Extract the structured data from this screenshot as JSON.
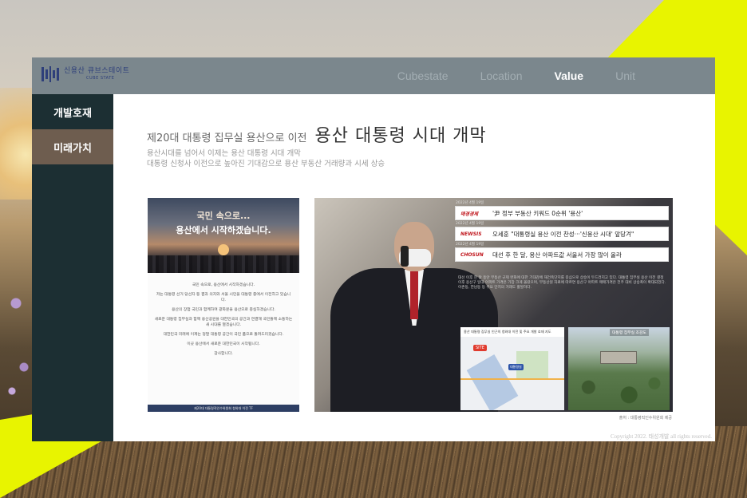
{
  "brand": {
    "name": "신용산 큐브스테이트",
    "sub": "CUBE STATE"
  },
  "nav": [
    {
      "label": "Cubestate"
    },
    {
      "label": "Location"
    },
    {
      "label": "Value"
    },
    {
      "label": "Unit"
    }
  ],
  "sidebar": [
    {
      "label": "개발호재"
    },
    {
      "label": "미래가치"
    }
  ],
  "headline": {
    "pre": "제20대 대통령 집무실 용산으로 이전",
    "main": "용산 대통령 시대 개막"
  },
  "subtitle": {
    "line1": "용산시대를 넘어서 이제는 용산 대통령 시대 개막",
    "line2": "대통령 신청사 이전으로 높아진 기대감으로 용산 부동산 거래량과 시세 상승"
  },
  "letter": {
    "title1": "국민 속으로...",
    "title2": "용산에서 시작하겠습니다.",
    "paragraphs": [
      "국민 속으로, 용산에서 시작하겠습니다.",
      "저는 대통령 선거 당선자 등 결과 의지와 서울 시민을 대통령 중에서 이전하고 있습니다.",
      "용산의 장점 국민과 함께하여 광화문을 용산으로 충실하겠습니다.",
      "새로운 대통령 집무실과 함께 용산공원을 대한민국의 공간과 연결해 국민들께 소통하는 새 시대를 열겠습니다.",
      "대한민국 미래에 이제는 정말 대통령 공간이 국민 품으로 돌려드리겠습니다.",
      "이곳 용산에서 새로운 대한민국이 시작됩니다.",
      "감사합니다."
    ],
    "footer": "제20대 대통령직인수위원회 청와대 이전 TF"
  },
  "news": [
    {
      "date": "2022년 4월 19일",
      "source": "매경경제",
      "text": "'尹 정부 부동산 키워드 0순위 '용산'"
    },
    {
      "date": "2022년 4월 19일",
      "source": "NEWSIS",
      "text": "오세훈 \"대통령실 용산 이전 찬성···'신용산 시대' 앞당겨\""
    },
    {
      "date": "2022년 4월 19일",
      "source": "CHOSUN",
      "text": "대선 후 한 달, 용산 아파트값 서울서 가장 많이 올라"
    }
  ],
  "photo_paragraph": "대선 이후 한 달 동안 부동산 규제 완화에 대한 기대감에 재건축단지를 중심으로 상승이 두드러지고 있다. 대통령 집무실 용산 이전 결정 이후 용산구 일대 아파트 가격은 가장 크게 올랐으며, 부동산원 자료에 따르면 용산구 아파트 매매가격은 전주 대비 상승폭이 확대되었다. 이촌동, 한남동 등 주요 단지의 거래도 활발하다.",
  "map": {
    "caption": "용산 대통령 집무실 인근의 청와대 이전 및 주요 개발 호재 지도",
    "pin": "SITE",
    "pin2": "대통령실"
  },
  "aerial": {
    "caption": "대통령 집무실 조감도"
  },
  "source": "출처 : 대통령직인수위원회 제공",
  "copyright": "Copyright 2022. 태성개발 all rights reserved.",
  "colors": {
    "accent_yellow": "#e8f400",
    "topbar": "#7b878d",
    "sidebar": "#1c2f33",
    "sidebar_active": "#6e5d4f",
    "brand_navy": "#2e3f7a"
  }
}
